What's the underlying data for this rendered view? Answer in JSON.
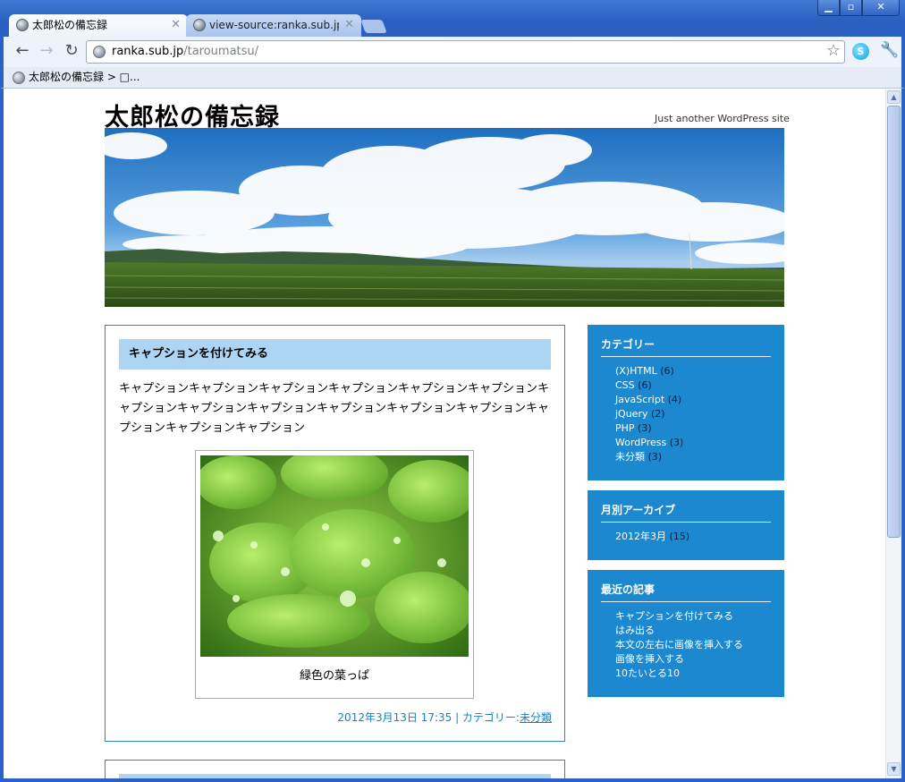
{
  "browser": {
    "tabs": [
      {
        "title": "太郎松の備忘録"
      },
      {
        "title": "view-source:ranka.sub.jp/tar"
      }
    ],
    "url_host": "ranka.sub.jp",
    "url_path": "/taroumatsu/",
    "bookmarks": [
      {
        "label": "太郎松の備忘録 > □..."
      }
    ]
  },
  "site": {
    "title": "太郎松の備忘録",
    "tagline": "Just another WordPress site"
  },
  "post": {
    "title": "キャプションを付けてみる",
    "body": "キャプションキャプションキャプションキャプションキャプションキャプションキャプションキャプションキャプションキャプションキャプションキャプションキャプションキャプションキャプション",
    "caption": "緑色の葉っぱ",
    "meta_date": "2012年3月13日 17:35 | カテゴリー:",
    "meta_category": "未分類"
  },
  "sidebar": {
    "categories": {
      "heading": "カテゴリー",
      "items": [
        {
          "label": "(X)HTML",
          "count": "(6)"
        },
        {
          "label": "CSS",
          "count": "(6)"
        },
        {
          "label": "JavaScript",
          "count": "(4)"
        },
        {
          "label": "jQuery",
          "count": "(2)"
        },
        {
          "label": "PHP",
          "count": "(3)"
        },
        {
          "label": "WordPress",
          "count": "(3)"
        },
        {
          "label": "未分類",
          "count": "(3)"
        }
      ]
    },
    "archives": {
      "heading": "月別アーカイブ",
      "items": [
        {
          "label": "2012年3月",
          "count": "(15)"
        }
      ]
    },
    "recent": {
      "heading": "最近の記事",
      "items": [
        {
          "label": "キャプションを付けてみる"
        },
        {
          "label": "はみ出る"
        },
        {
          "label": "本文の左右に画像を挿入する"
        },
        {
          "label": "画像を挿入する"
        },
        {
          "label": "10たいとる10"
        }
      ]
    }
  },
  "colors": {
    "accent_blue": "#1c88cf",
    "title_bar_blue": "#aed4f4",
    "link_blue": "#1b7fc0"
  }
}
